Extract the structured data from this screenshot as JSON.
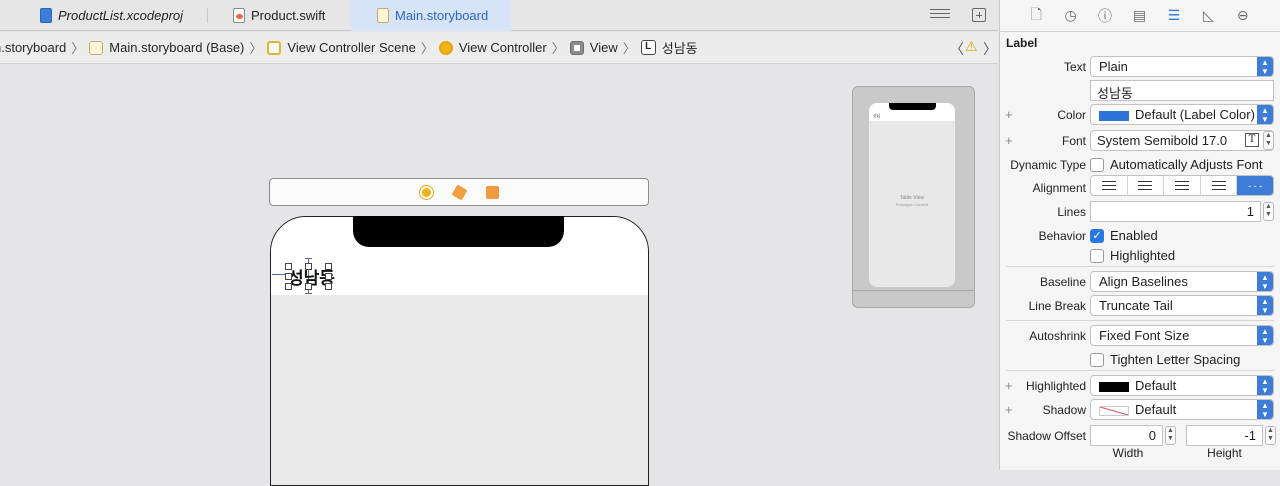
{
  "tabs": [
    {
      "label": "ProductList.xcodeproj",
      "icon": "xcodeproj-icon"
    },
    {
      "label": "Product.swift",
      "icon": "swift-file-icon"
    },
    {
      "label": "Main.storyboard",
      "icon": "storyboard-icon",
      "active": true
    }
  ],
  "breadcrumb": [
    {
      "label": "n.storyboard",
      "icon": "storyboard-icon"
    },
    {
      "label": "Main.storyboard (Base)",
      "icon": "storyboard-icon"
    },
    {
      "label": "View Controller Scene",
      "icon": "scene-icon"
    },
    {
      "label": "View Controller",
      "icon": "view-controller-icon"
    },
    {
      "label": "View",
      "icon": "view-icon"
    },
    {
      "label": "성남동",
      "icon": "label-icon",
      "glyph": "L"
    }
  ],
  "canvas": {
    "label_text": "성남동",
    "thumb_title": "Table View",
    "thumb_subtitle": "Prototype Content"
  },
  "inspector": {
    "section": "Label",
    "text": {
      "label": "Text",
      "value": "Plain",
      "content": "성남동"
    },
    "color": {
      "label": "Color",
      "value": "Default (Label Color)",
      "swatch": "#2d74da"
    },
    "font": {
      "label": "Font",
      "value": "System Semibold 17.0"
    },
    "dynamic_type": {
      "label": "Dynamic Type",
      "value": "Automatically Adjusts Font"
    },
    "alignment": {
      "label": "Alignment"
    },
    "lines": {
      "label": "Lines",
      "value": "1"
    },
    "behavior": {
      "label": "Behavior",
      "enabled": "Enabled",
      "highlighted": "Highlighted"
    },
    "baseline": {
      "label": "Baseline",
      "value": "Align Baselines"
    },
    "line_break": {
      "label": "Line Break",
      "value": "Truncate Tail"
    },
    "autoshrink": {
      "label": "Autoshrink",
      "value": "Fixed Font Size",
      "tighten": "Tighten Letter Spacing"
    },
    "highlighted": {
      "label": "Highlighted",
      "value": "Default",
      "swatch": "#000000"
    },
    "shadow": {
      "label": "Shadow",
      "value": "Default"
    },
    "shadow_offset": {
      "label": "Shadow Offset",
      "width": "0",
      "height": "-1",
      "width_label": "Width",
      "height_label": "Height"
    }
  },
  "colors": {
    "accent": "#2b78e4",
    "selection_tab": "#d7e4f7"
  }
}
